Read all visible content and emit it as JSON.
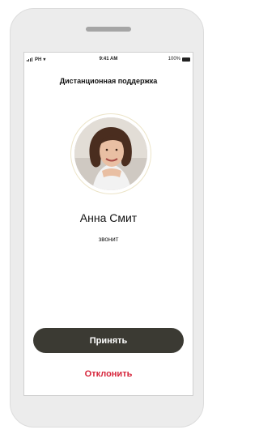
{
  "status_bar": {
    "carrier": "PH",
    "time": "9:41 AM",
    "battery": "100%"
  },
  "screen_title": "Дистанционная поддержка",
  "caller": {
    "name": "Анна Смит",
    "status": "звонит"
  },
  "actions": {
    "accept_label": "Принять",
    "decline_label": "Отклонить"
  },
  "colors": {
    "accept_bg": "#3b3a33",
    "decline_text": "#d6243a",
    "ring": "#ece4c8"
  }
}
